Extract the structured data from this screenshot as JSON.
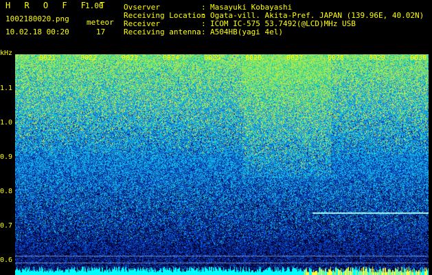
{
  "app": {
    "title": "H R O F F T",
    "version": "1.00"
  },
  "file_name": "1002180020.png",
  "event_type": "meteor",
  "datetime": "10.02.18 00:20",
  "count": "17",
  "info": [
    {
      "label": "Ovserver",
      "value": "Masayuki Kobayashi"
    },
    {
      "label": "Receiving Location",
      "value": "Ogata-vill. Akita-Pref. JAPAN (139.96E, 40.02N)"
    },
    {
      "label": "Receiver",
      "value": "ICOM IC-575 53.7492(@LCD)MHz USB"
    },
    {
      "label": "Receiving antenna",
      "value": "A504HB(yagi 4el)"
    }
  ],
  "info_separator": ":",
  "y_axis": {
    "unit": "kHz",
    "ticks": [
      {
        "label": "1.1",
        "khz": 1.1
      },
      {
        "label": "1.0",
        "khz": 1.0
      },
      {
        "label": "0.9",
        "khz": 0.9
      },
      {
        "label": "0.8",
        "khz": 0.8
      },
      {
        "label": "0.7",
        "khz": 0.7
      },
      {
        "label": "0.6",
        "khz": 0.6
      }
    ]
  },
  "x_axis": {
    "ticks": [
      "0021",
      "0022",
      "0023",
      "0024",
      "0025",
      "0026",
      "0027",
      "0028",
      "0029",
      "0030"
    ]
  },
  "signals": [
    {
      "type": "carrier",
      "khz": 0.74,
      "from_fraction": 0.72,
      "to_fraction": 1.0,
      "color": "#a8ffff"
    },
    {
      "type": "reference-line",
      "khz": 0.615,
      "color": "#c8d8ff"
    },
    {
      "type": "reference-line",
      "khz": 0.595,
      "color": "#c8d8ff"
    }
  ],
  "colors": {
    "label": "#ffff00",
    "background": "#000000",
    "noise_low": "#05055a",
    "noise_mid": "#1e6eff",
    "noise_high": "#00e6a0",
    "bottom_band": "#00ffff",
    "bottom_band_end": "#ffff40"
  }
}
